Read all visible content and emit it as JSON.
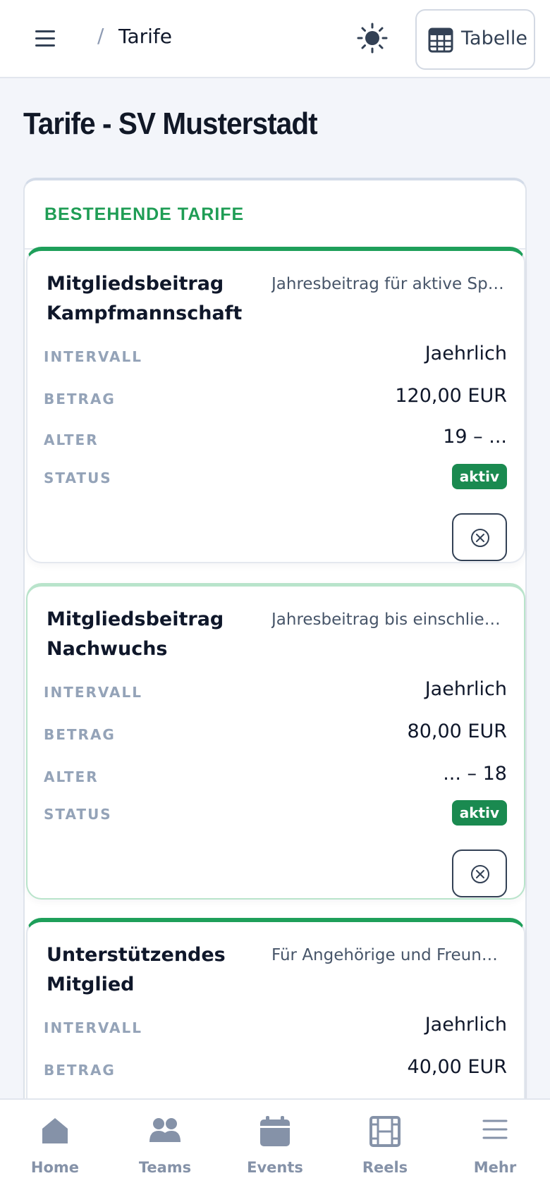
{
  "header": {
    "breadcrumb_separator": "/",
    "title": "Tarife",
    "table_button_label": "Tabelle"
  },
  "page": {
    "title": "Tarife - SV Musterstadt"
  },
  "section": {
    "title": "BESTEHENDE TARIFE"
  },
  "labels": {
    "interval": "INTERVALL",
    "amount": "BETRAG",
    "age": "ALTER",
    "status": "STATUS"
  },
  "tariffs": [
    {
      "name": "Mitgliedsbeitrag Kampfmannschaft",
      "description": "Jahresbeitrag für aktive Spi...",
      "interval": "Jaehrlich",
      "amount": "120,00 EUR",
      "age": "19 – ...",
      "status": "aktiv"
    },
    {
      "name": "Mitgliedsbeitrag Nachwuchs",
      "description": "Jahresbeitrag bis einschließli...",
      "interval": "Jaehrlich",
      "amount": "80,00 EUR",
      "age": "... – 18",
      "status": "aktiv"
    },
    {
      "name": "Unterstützendes Mitglied",
      "description": "Für Angehörige und Freunde d...",
      "interval": "Jaehrlich",
      "amount": "40,00 EUR"
    }
  ],
  "bottom_nav": [
    {
      "label": "Home",
      "icon": "home-icon"
    },
    {
      "label": "Teams",
      "icon": "users-icon"
    },
    {
      "label": "Events",
      "icon": "calendar-icon"
    },
    {
      "label": "Reels",
      "icon": "film-icon"
    },
    {
      "label": "Mehr",
      "icon": "menu-icon"
    }
  ],
  "colors": {
    "accent_green": "#1e9f5a",
    "badge_green": "#1a8a50",
    "section_title_green": "#1f9d55",
    "background": "#f3f5fa"
  }
}
